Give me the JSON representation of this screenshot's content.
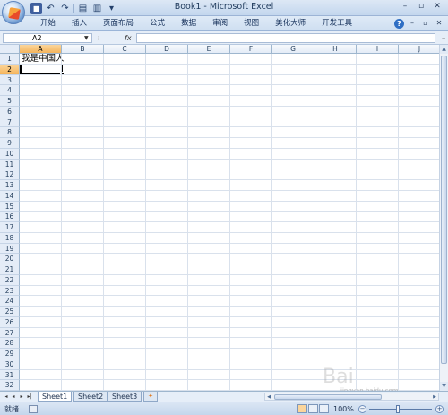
{
  "window": {
    "title": "Book1 - Microsoft Excel"
  },
  "ribbon": {
    "tabs": [
      "开始",
      "插入",
      "页面布局",
      "公式",
      "数据",
      "审阅",
      "视图",
      "美化大师",
      "开发工具"
    ]
  },
  "formula_bar": {
    "name_box": "A2",
    "fx_label": "fx",
    "content": ""
  },
  "columns": [
    "A",
    "B",
    "C",
    "D",
    "E",
    "F",
    "G",
    "H",
    "I",
    "J"
  ],
  "rows": [
    "1",
    "2",
    "3",
    "4",
    "5",
    "6",
    "7",
    "8",
    "9",
    "10",
    "11",
    "12",
    "13",
    "14",
    "15",
    "16",
    "17",
    "18",
    "19",
    "20",
    "21",
    "22",
    "23",
    "24",
    "25",
    "26",
    "27",
    "28",
    "29",
    "30",
    "31",
    "32"
  ],
  "cells": {
    "A1": "我是中国人"
  },
  "selection": {
    "active_cell": "A2",
    "active_column": "A",
    "active_row": "2"
  },
  "sheets": {
    "tabs": [
      "Sheet1",
      "Sheet2",
      "Sheet3"
    ],
    "active": "Sheet1"
  },
  "status": {
    "ready": "就绪",
    "zoom": "100%"
  },
  "watermark": {
    "text": "Bai",
    "sub": "jingyan.baidu.com"
  },
  "colors": {
    "accent": "#f5b45b",
    "ribbon": "#cfdff1",
    "gridline": "#d9e1ec"
  }
}
